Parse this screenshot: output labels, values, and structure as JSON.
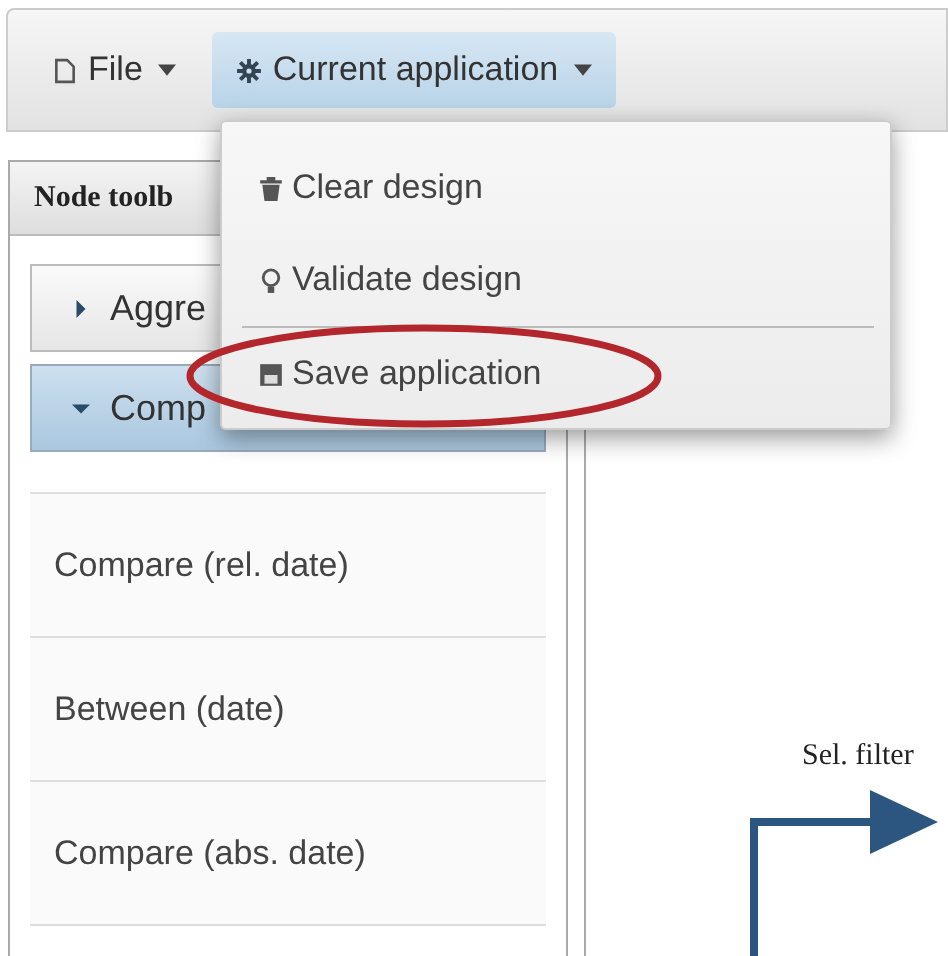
{
  "menubar": {
    "items": [
      {
        "label": "File",
        "selected": false
      },
      {
        "label": "Current application",
        "selected": true
      }
    ]
  },
  "dropdown": {
    "items": [
      {
        "kind": "item",
        "label": "Clear design",
        "highlighted": false
      },
      {
        "kind": "item",
        "label": "Validate design",
        "highlighted": false
      },
      {
        "kind": "divider"
      },
      {
        "kind": "item",
        "label": "Save application",
        "highlighted": true
      }
    ]
  },
  "sidebar": {
    "title": "Node toolb",
    "groups": [
      {
        "label": "Aggre",
        "expanded": false
      },
      {
        "label": "Comp",
        "expanded": true
      }
    ],
    "items": [
      "Compare (rel. date)",
      "Between (date)",
      "Compare (abs. date)"
    ]
  },
  "canvas": {
    "node_label": "Sel. filter"
  }
}
